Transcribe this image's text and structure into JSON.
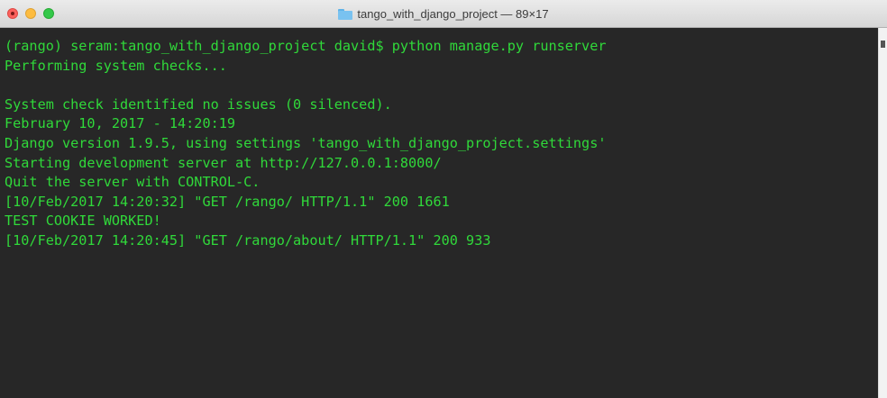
{
  "window": {
    "title": "tango_with_django_project — 89×17",
    "icon": "folder-icon"
  },
  "colors": {
    "terminal_bg": "#272727",
    "terminal_text": "#30d93a",
    "close": "#fc605c",
    "minimize": "#fdbc40",
    "maximize": "#34c84a"
  },
  "terminal": {
    "lines": [
      "(rango) seram:tango_with_django_project david$ python manage.py runserver",
      "Performing system checks...",
      "",
      "System check identified no issues (0 silenced).",
      "February 10, 2017 - 14:20:19",
      "Django version 1.9.5, using settings 'tango_with_django_project.settings'",
      "Starting development server at http://127.0.0.1:8000/",
      "Quit the server with CONTROL-C.",
      "[10/Feb/2017 14:20:32] \"GET /rango/ HTTP/1.1\" 200 1661",
      "TEST COOKIE WORKED!",
      "[10/Feb/2017 14:20:45] \"GET /rango/about/ HTTP/1.1\" 200 933"
    ]
  }
}
